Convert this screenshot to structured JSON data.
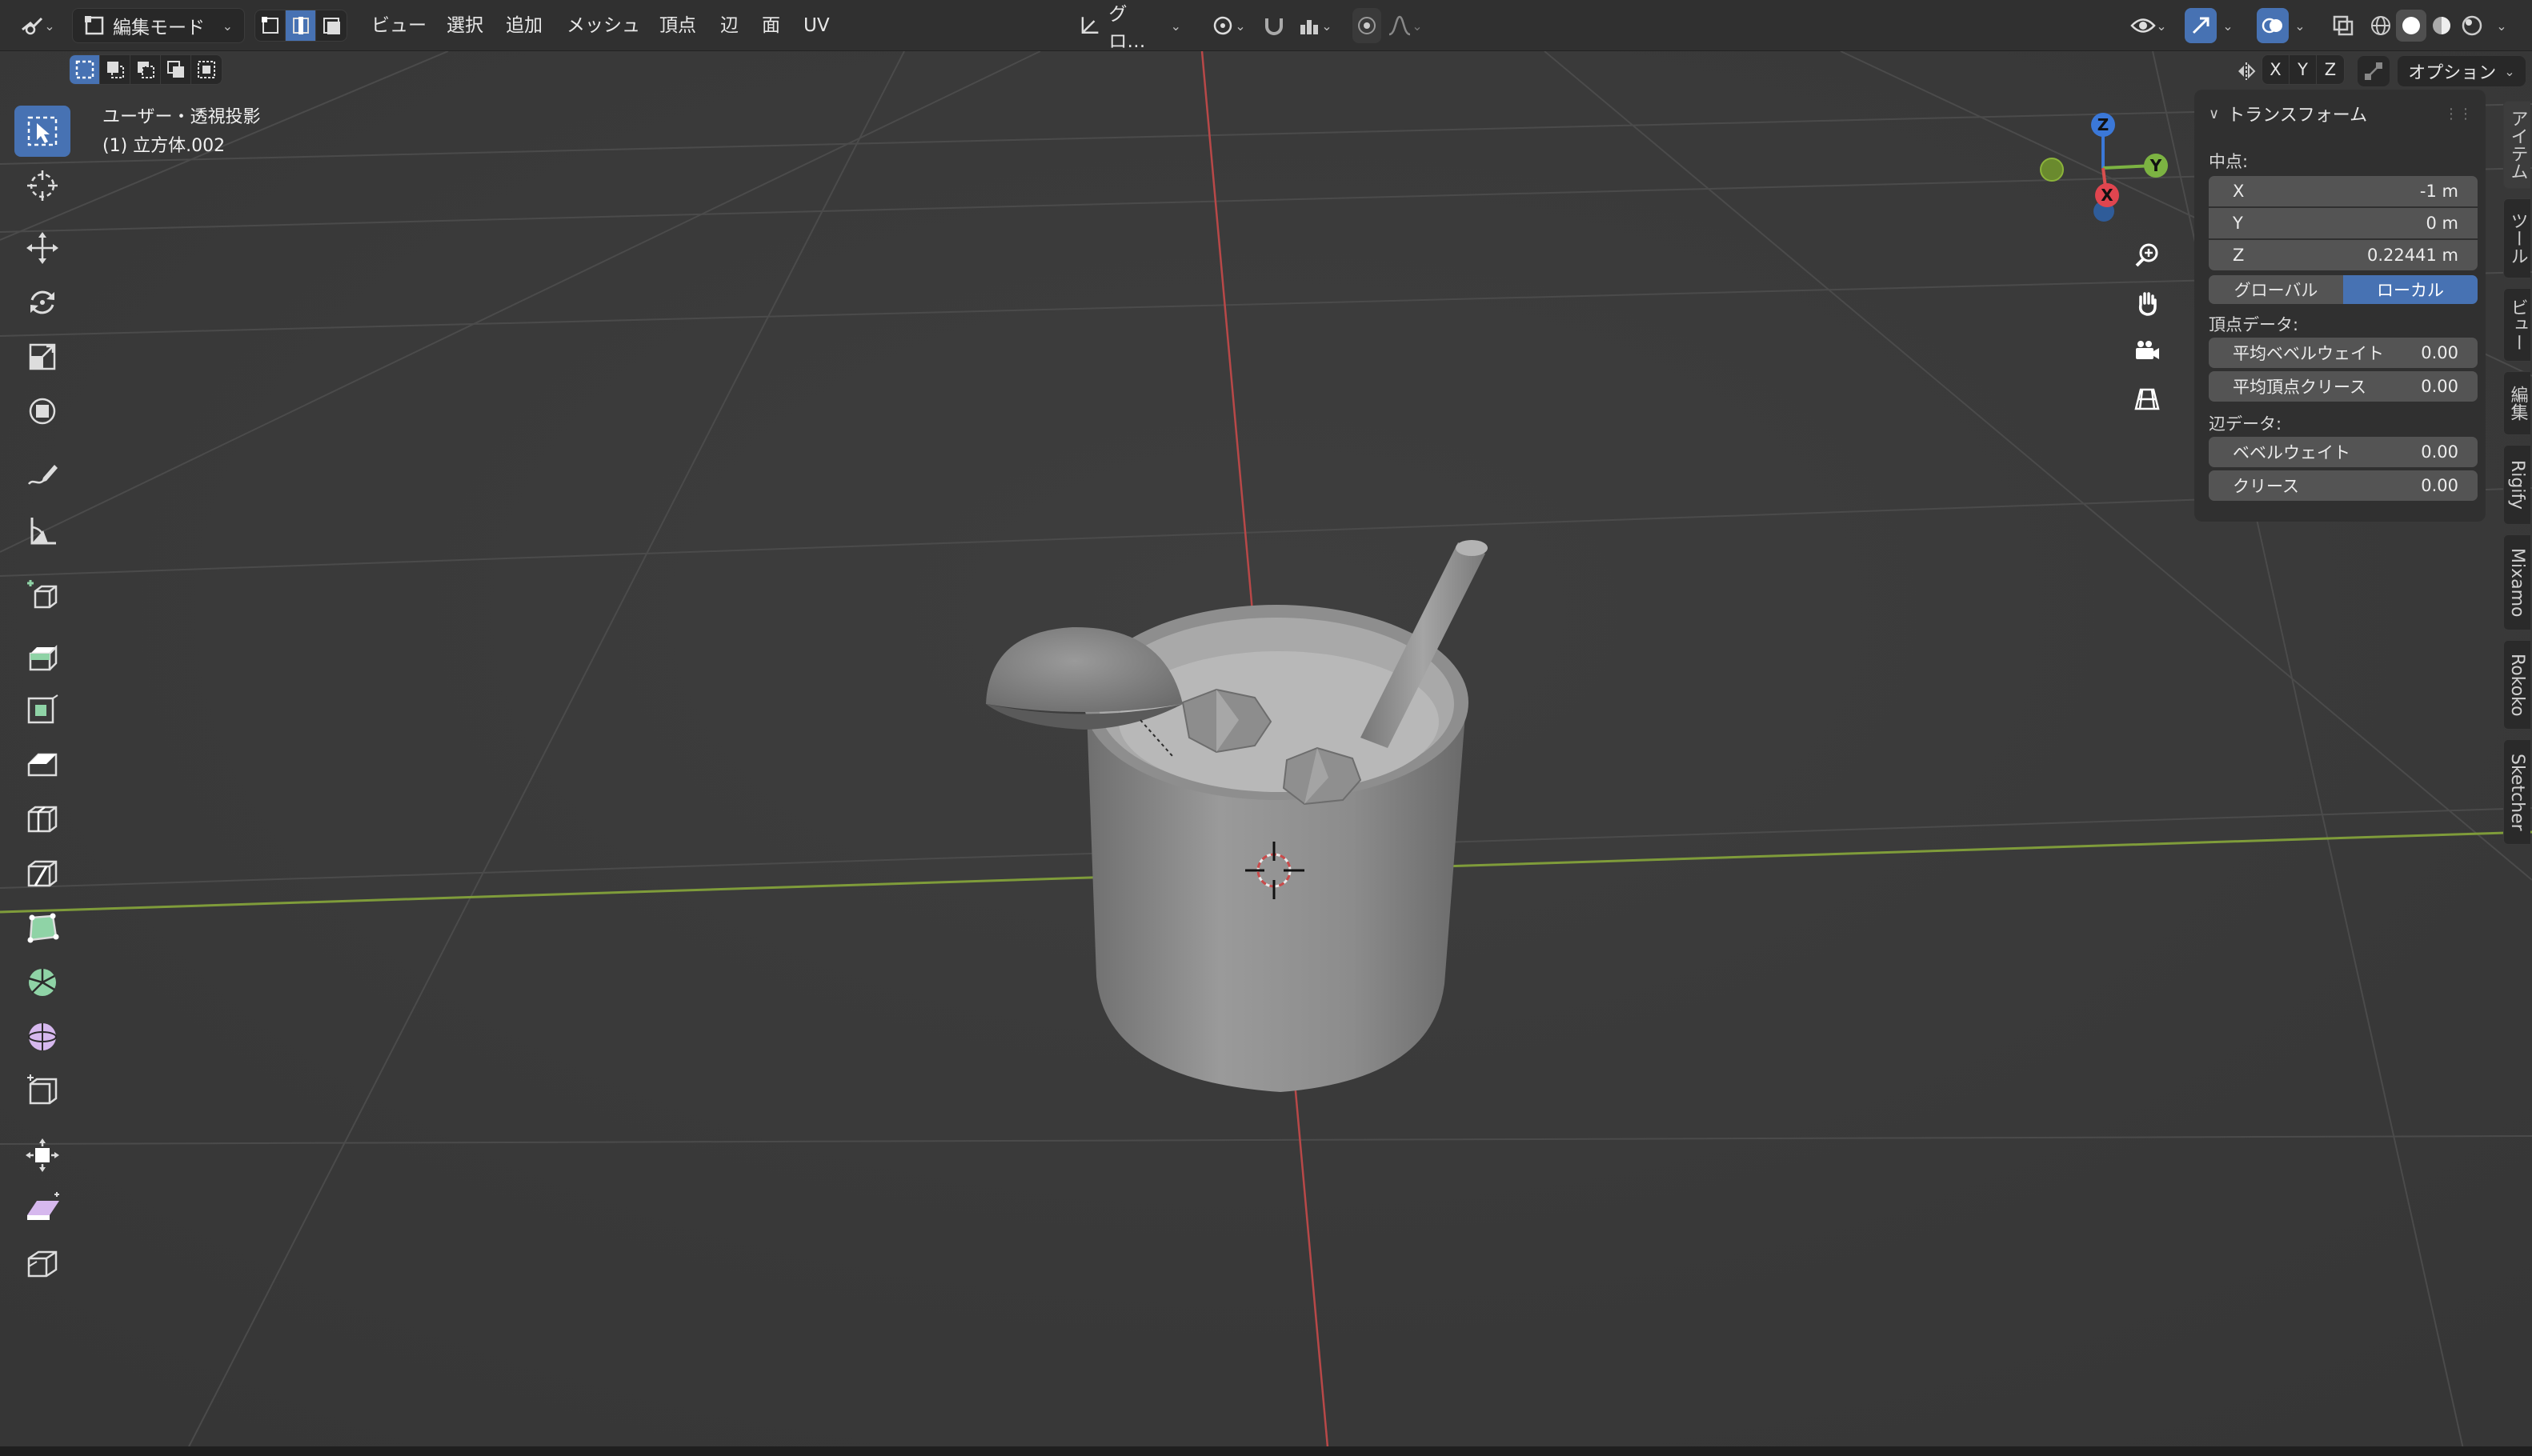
{
  "header": {
    "mode": "編集モード",
    "menus": [
      "ビュー",
      "選択",
      "追加",
      "メッシュ",
      "頂点",
      "辺",
      "面",
      "UV"
    ],
    "transform_orientation": "グロ…"
  },
  "subbar": {
    "axes": [
      "X",
      "Y",
      "Z"
    ],
    "options_label": "オプション"
  },
  "viewport": {
    "view_label": "ユーザー・透視投影",
    "object_label": "(1) 立方体.002",
    "colors": {
      "x_axis": "#c94a4a",
      "y_axis": "#8bb33a",
      "background": "#3d3d3d",
      "grid": "#4a4a4a",
      "accent": "#4772b3"
    }
  },
  "gizmo": {
    "x": "X",
    "y": "Y",
    "z": "Z"
  },
  "toolbar": {
    "tools": [
      "select-box",
      "cursor",
      "move",
      "rotate",
      "scale",
      "transform",
      "annotate",
      "measure",
      "add-cube",
      "extrude",
      "inset",
      "bevel",
      "loop-cut",
      "knife",
      "poly-build",
      "spin",
      "smooth",
      "edge-slide",
      "shrink-fatten",
      "shear",
      "rip-region"
    ]
  },
  "npanel": {
    "header": "トランスフォーム",
    "median_label": "中点:",
    "fields": [
      {
        "label": "X",
        "value": "-1 m"
      },
      {
        "label": "Y",
        "value": "0 m"
      },
      {
        "label": "Z",
        "value": "0.22441 m"
      }
    ],
    "global_label": "グローバル",
    "local_label": "ローカル",
    "vertex_data_label": "頂点データ:",
    "vertex_fields": [
      {
        "label": "平均ベベルウェイト",
        "value": "0.00"
      },
      {
        "label": "平均頂点クリース",
        "value": "0.00"
      }
    ],
    "edge_data_label": "辺データ:",
    "edge_fields": [
      {
        "label": "ベベルウェイト",
        "value": "0.00"
      },
      {
        "label": "クリース",
        "value": "0.00"
      }
    ]
  },
  "tabs": [
    "アイテム",
    "ツール",
    "ビュー",
    "編集",
    "Rigify",
    "Mixamo",
    "Rokoko",
    "Sketcher"
  ]
}
